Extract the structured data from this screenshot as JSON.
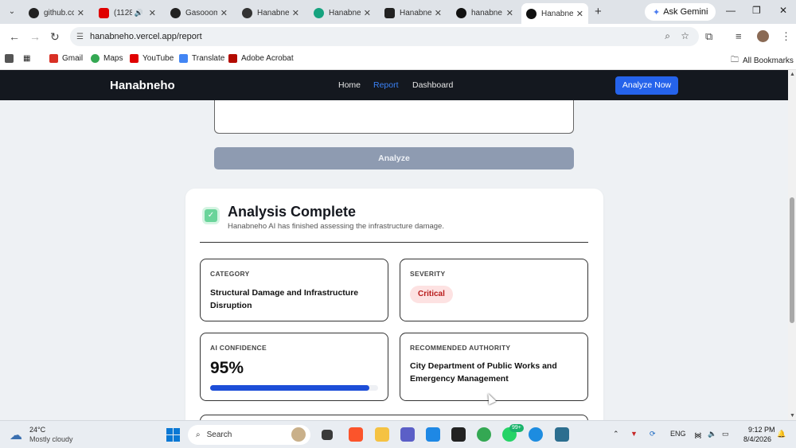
{
  "browser": {
    "tabs": [
      {
        "label": "github.cc",
        "icon": "github-icon",
        "color": "#222222"
      },
      {
        "label": "(1128",
        "icon": "youtube-icon",
        "color": "#e00000"
      },
      {
        "label": "Gasooom",
        "icon": "github-icon",
        "color": "#222222"
      },
      {
        "label": "Hanabne",
        "icon": "app-icon",
        "color": "#333333"
      },
      {
        "label": "Hanabne",
        "icon": "feather-icon",
        "color": "#16a37f"
      },
      {
        "label": "Hanabne",
        "icon": "app-icon",
        "color": "#222222"
      },
      {
        "label": "hanabne",
        "icon": "vercel-icon",
        "color": "#111111"
      },
      {
        "label": "Hanabne",
        "icon": "vercel-icon",
        "color": "#111111",
        "active": true
      }
    ],
    "gemini_label": "Ask Gemini",
    "url": "hanabneho.vercel.app/report",
    "bookmarks": [
      {
        "label": "Gmail",
        "icon": "gmail-icon",
        "color": "#d93025"
      },
      {
        "label": "Maps",
        "icon": "maps-icon",
        "color": "#34a853"
      },
      {
        "label": "YouTube",
        "icon": "youtube-icon",
        "color": "#e00000"
      },
      {
        "label": "Translate",
        "icon": "translate-icon",
        "color": "#4285f4"
      },
      {
        "label": "Adobe Acrobat",
        "icon": "acrobat-icon",
        "color": "#b30b00"
      }
    ],
    "all_bookmarks": "All Bookmarks"
  },
  "site": {
    "brand": "Hanabneho",
    "nav": {
      "home": "Home",
      "report": "Report",
      "dashboard": "Dashboard"
    },
    "cta": "Analyze Now",
    "analyze_button": "Analyze"
  },
  "result": {
    "title": "Analysis Complete",
    "subtitle": "Hanabneho AI has finished assessing the infrastructure damage.",
    "category": {
      "label": "CATEGORY",
      "value": "Structural Damage and Infrastructure Disruption"
    },
    "severity": {
      "label": "SEVERITY",
      "value": "Critical"
    },
    "confidence": {
      "label": "AI CONFIDENCE",
      "value": "95%",
      "percent": 95
    },
    "authority": {
      "label": "RECOMMENDED AUTHORITY",
      "value": "City Department of Public Works and Emergency Management"
    }
  },
  "taskbar": {
    "temp": "24°C",
    "weather": "Mostly cloudy",
    "search": "Search",
    "lang": "ENG",
    "time": "9:12 PM",
    "date": "8/4/2026",
    "notification_badge": "99+"
  },
  "colors": {
    "accent": "#2563eb",
    "nav_bg": "#14181f",
    "critical": "#b91c1c",
    "success": "#6ad49a"
  }
}
